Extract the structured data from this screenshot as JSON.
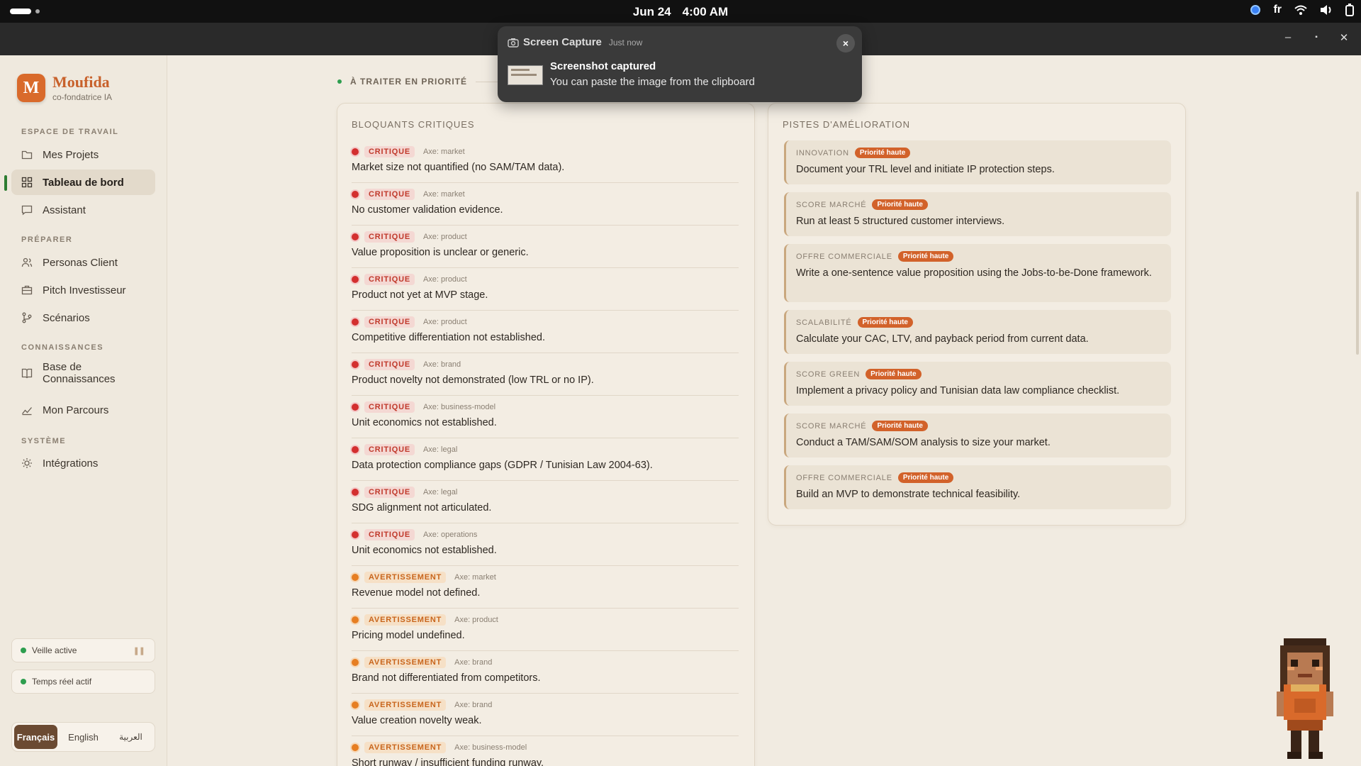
{
  "system_bar": {
    "date": "Jun 24",
    "time": "4:00 AM",
    "keyboard_layout": "fr"
  },
  "notification": {
    "app_name": "Screen Capture",
    "when": "Just now",
    "title": "Screenshot captured",
    "body": "You can paste the image from the clipboard",
    "close_label": "×"
  },
  "window": {
    "minimize": "–",
    "maximize": "▪",
    "close": "✕"
  },
  "brand": {
    "initial": "M",
    "name": "Moufida",
    "subtitle": "co-fondatrice IA"
  },
  "sidebar": {
    "sections": {
      "workspace": "ESPACE DE TRAVAIL",
      "prepare": "PRÉPARER",
      "knowledge": "CONNAISSANCES",
      "system": "SYSTÈME"
    },
    "items": [
      {
        "label": "Mes Projets",
        "icon": "folder-icon"
      },
      {
        "label": "Tableau de bord",
        "icon": "grid-icon",
        "active": true
      },
      {
        "label": "Assistant",
        "icon": "chat-icon"
      },
      {
        "label": "Personas Client",
        "icon": "users-icon"
      },
      {
        "label": "Pitch Investisseur",
        "icon": "briefcase-icon"
      },
      {
        "label": "Scénarios",
        "icon": "branch-icon"
      },
      {
        "label": "Base de Connaissances",
        "icon": "book-icon"
      },
      {
        "label": "Mon Parcours",
        "icon": "trend-icon"
      },
      {
        "label": "Intégrations",
        "icon": "sun-icon"
      }
    ],
    "status": {
      "watch": "Veille active",
      "realtime": "Temps réel actif"
    },
    "languages": [
      "Français",
      "English",
      "العربية"
    ],
    "selected_language": "Français"
  },
  "main": {
    "priority_label": "À TRAITER EN PRIORITÉ",
    "blockers": {
      "title": "BLOQUANTS CRITIQUES",
      "items": [
        {
          "severity": "CRITIQUE",
          "axis": "Axe: market",
          "text": "Market size not quantified (no SAM/TAM data)."
        },
        {
          "severity": "CRITIQUE",
          "axis": "Axe: market",
          "text": "No customer validation evidence."
        },
        {
          "severity": "CRITIQUE",
          "axis": "Axe: product",
          "text": "Value proposition is unclear or generic."
        },
        {
          "severity": "CRITIQUE",
          "axis": "Axe: product",
          "text": "Product not yet at MVP stage."
        },
        {
          "severity": "CRITIQUE",
          "axis": "Axe: product",
          "text": "Competitive differentiation not established."
        },
        {
          "severity": "CRITIQUE",
          "axis": "Axe: brand",
          "text": "Product novelty not demonstrated (low TRL or no IP)."
        },
        {
          "severity": "CRITIQUE",
          "axis": "Axe: business-model",
          "text": "Unit economics not established."
        },
        {
          "severity": "CRITIQUE",
          "axis": "Axe: legal",
          "text": "Data protection compliance gaps (GDPR / Tunisian Law 2004-63)."
        },
        {
          "severity": "CRITIQUE",
          "axis": "Axe: legal",
          "text": "SDG alignment not articulated."
        },
        {
          "severity": "CRITIQUE",
          "axis": "Axe: operations",
          "text": "Unit economics not established."
        },
        {
          "severity": "AVERTISSEMENT",
          "axis": "Axe: market",
          "text": "Revenue model not defined."
        },
        {
          "severity": "AVERTISSEMENT",
          "axis": "Axe: product",
          "text": "Pricing model undefined."
        },
        {
          "severity": "AVERTISSEMENT",
          "axis": "Axe: brand",
          "text": "Brand not differentiated from competitors."
        },
        {
          "severity": "AVERTISSEMENT",
          "axis": "Axe: brand",
          "text": "Value creation novelty weak."
        },
        {
          "severity": "AVERTISSEMENT",
          "axis": "Axe: business-model",
          "text": "Short runway / insufficient funding runway."
        }
      ]
    },
    "improvements": {
      "title": "PISTES D'AMÉLIORATION",
      "items": [
        {
          "category": "INNOVATION",
          "priority": "Priorité haute",
          "text": "Document your TRL level and initiate IP protection steps."
        },
        {
          "category": "SCORE MARCHÉ",
          "priority": "Priorité haute",
          "text": "Run at least 5 structured customer interviews."
        },
        {
          "category": "OFFRE COMMERCIALE",
          "priority": "Priorité haute",
          "text": "Write a one-sentence value proposition using the Jobs-to-be-Done framework."
        },
        {
          "category": "SCALABILITÉ",
          "priority": "Priorité haute",
          "text": "Calculate your CAC, LTV, and payback period from current data."
        },
        {
          "category": "SCORE GREEN",
          "priority": "Priorité haute",
          "text": "Implement a privacy policy and Tunisian data law compliance checklist."
        },
        {
          "category": "SCORE MARCHÉ",
          "priority": "Priorité haute",
          "text": "Conduct a TAM/SAM/SOM analysis to size your market."
        },
        {
          "category": "OFFRE COMMERCIALE",
          "priority": "Priorité haute",
          "text": "Build an MVP to demonstrate technical feasibility."
        }
      ]
    }
  }
}
